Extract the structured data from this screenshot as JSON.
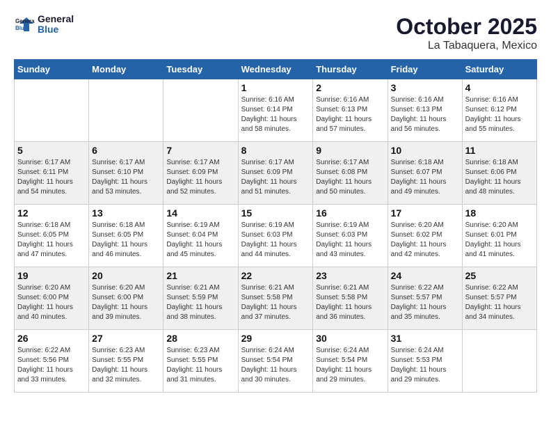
{
  "header": {
    "logo_line1": "General",
    "logo_line2": "Blue",
    "month": "October 2025",
    "location": "La Tabaquera, Mexico"
  },
  "weekdays": [
    "Sunday",
    "Monday",
    "Tuesday",
    "Wednesday",
    "Thursday",
    "Friday",
    "Saturday"
  ],
  "weeks": [
    [
      {
        "day": "",
        "info": ""
      },
      {
        "day": "",
        "info": ""
      },
      {
        "day": "",
        "info": ""
      },
      {
        "day": "1",
        "info": "Sunrise: 6:16 AM\nSunset: 6:14 PM\nDaylight: 11 hours\nand 58 minutes."
      },
      {
        "day": "2",
        "info": "Sunrise: 6:16 AM\nSunset: 6:13 PM\nDaylight: 11 hours\nand 57 minutes."
      },
      {
        "day": "3",
        "info": "Sunrise: 6:16 AM\nSunset: 6:13 PM\nDaylight: 11 hours\nand 56 minutes."
      },
      {
        "day": "4",
        "info": "Sunrise: 6:16 AM\nSunset: 6:12 PM\nDaylight: 11 hours\nand 55 minutes."
      }
    ],
    [
      {
        "day": "5",
        "info": "Sunrise: 6:17 AM\nSunset: 6:11 PM\nDaylight: 11 hours\nand 54 minutes."
      },
      {
        "day": "6",
        "info": "Sunrise: 6:17 AM\nSunset: 6:10 PM\nDaylight: 11 hours\nand 53 minutes."
      },
      {
        "day": "7",
        "info": "Sunrise: 6:17 AM\nSunset: 6:09 PM\nDaylight: 11 hours\nand 52 minutes."
      },
      {
        "day": "8",
        "info": "Sunrise: 6:17 AM\nSunset: 6:09 PM\nDaylight: 11 hours\nand 51 minutes."
      },
      {
        "day": "9",
        "info": "Sunrise: 6:17 AM\nSunset: 6:08 PM\nDaylight: 11 hours\nand 50 minutes."
      },
      {
        "day": "10",
        "info": "Sunrise: 6:18 AM\nSunset: 6:07 PM\nDaylight: 11 hours\nand 49 minutes."
      },
      {
        "day": "11",
        "info": "Sunrise: 6:18 AM\nSunset: 6:06 PM\nDaylight: 11 hours\nand 48 minutes."
      }
    ],
    [
      {
        "day": "12",
        "info": "Sunrise: 6:18 AM\nSunset: 6:05 PM\nDaylight: 11 hours\nand 47 minutes."
      },
      {
        "day": "13",
        "info": "Sunrise: 6:18 AM\nSunset: 6:05 PM\nDaylight: 11 hours\nand 46 minutes."
      },
      {
        "day": "14",
        "info": "Sunrise: 6:19 AM\nSunset: 6:04 PM\nDaylight: 11 hours\nand 45 minutes."
      },
      {
        "day": "15",
        "info": "Sunrise: 6:19 AM\nSunset: 6:03 PM\nDaylight: 11 hours\nand 44 minutes."
      },
      {
        "day": "16",
        "info": "Sunrise: 6:19 AM\nSunset: 6:03 PM\nDaylight: 11 hours\nand 43 minutes."
      },
      {
        "day": "17",
        "info": "Sunrise: 6:20 AM\nSunset: 6:02 PM\nDaylight: 11 hours\nand 42 minutes."
      },
      {
        "day": "18",
        "info": "Sunrise: 6:20 AM\nSunset: 6:01 PM\nDaylight: 11 hours\nand 41 minutes."
      }
    ],
    [
      {
        "day": "19",
        "info": "Sunrise: 6:20 AM\nSunset: 6:00 PM\nDaylight: 11 hours\nand 40 minutes."
      },
      {
        "day": "20",
        "info": "Sunrise: 6:20 AM\nSunset: 6:00 PM\nDaylight: 11 hours\nand 39 minutes."
      },
      {
        "day": "21",
        "info": "Sunrise: 6:21 AM\nSunset: 5:59 PM\nDaylight: 11 hours\nand 38 minutes."
      },
      {
        "day": "22",
        "info": "Sunrise: 6:21 AM\nSunset: 5:58 PM\nDaylight: 11 hours\nand 37 minutes."
      },
      {
        "day": "23",
        "info": "Sunrise: 6:21 AM\nSunset: 5:58 PM\nDaylight: 11 hours\nand 36 minutes."
      },
      {
        "day": "24",
        "info": "Sunrise: 6:22 AM\nSunset: 5:57 PM\nDaylight: 11 hours\nand 35 minutes."
      },
      {
        "day": "25",
        "info": "Sunrise: 6:22 AM\nSunset: 5:57 PM\nDaylight: 11 hours\nand 34 minutes."
      }
    ],
    [
      {
        "day": "26",
        "info": "Sunrise: 6:22 AM\nSunset: 5:56 PM\nDaylight: 11 hours\nand 33 minutes."
      },
      {
        "day": "27",
        "info": "Sunrise: 6:23 AM\nSunset: 5:55 PM\nDaylight: 11 hours\nand 32 minutes."
      },
      {
        "day": "28",
        "info": "Sunrise: 6:23 AM\nSunset: 5:55 PM\nDaylight: 11 hours\nand 31 minutes."
      },
      {
        "day": "29",
        "info": "Sunrise: 6:24 AM\nSunset: 5:54 PM\nDaylight: 11 hours\nand 30 minutes."
      },
      {
        "day": "30",
        "info": "Sunrise: 6:24 AM\nSunset: 5:54 PM\nDaylight: 11 hours\nand 29 minutes."
      },
      {
        "day": "31",
        "info": "Sunrise: 6:24 AM\nSunset: 5:53 PM\nDaylight: 11 hours\nand 29 minutes."
      },
      {
        "day": "",
        "info": ""
      }
    ]
  ]
}
